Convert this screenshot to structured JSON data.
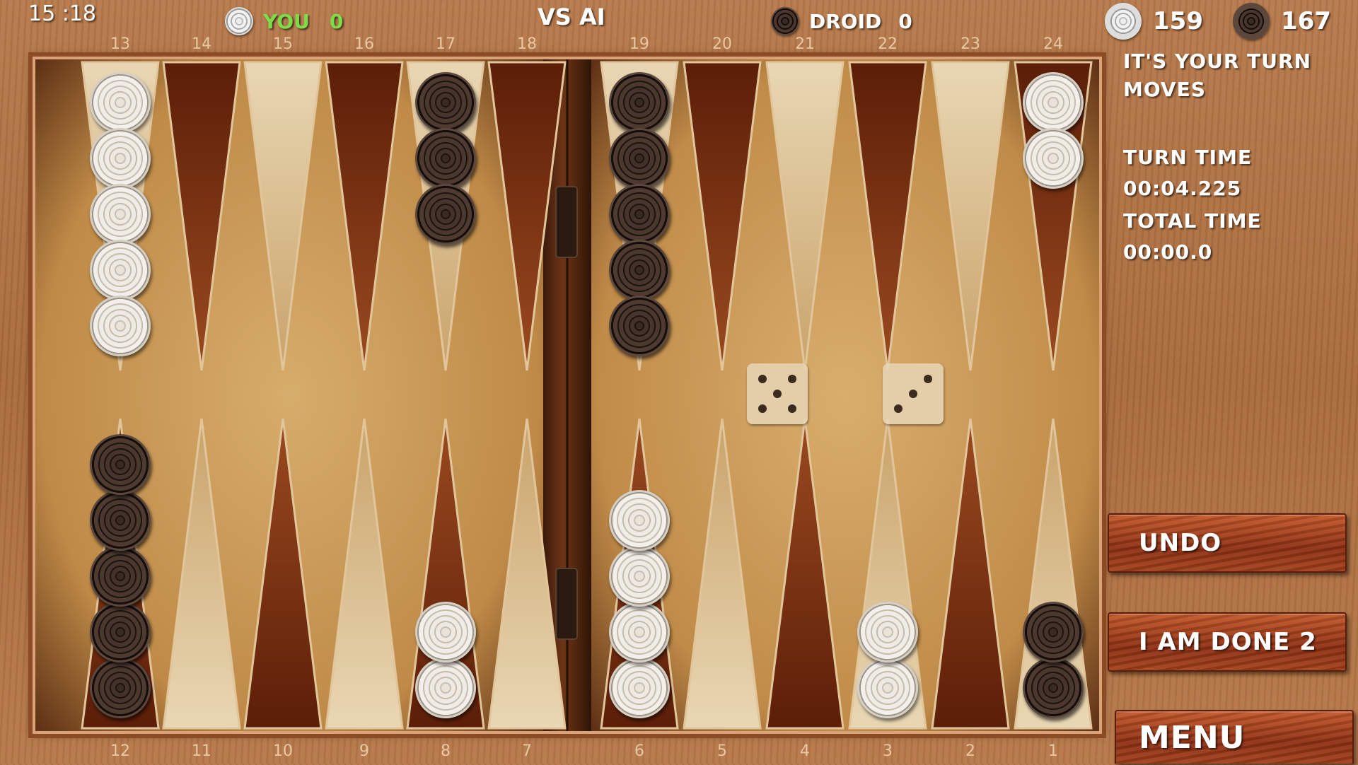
{
  "header": {
    "clock": "15 :18",
    "player_name": "YOU",
    "player_score": "0",
    "mode": "VS AI",
    "opponent_name": "DROID",
    "opponent_score": "0",
    "white_pips": "159",
    "black_pips": "167",
    "colors": {
      "player_name": "#7ddc4a",
      "text": "#ffffff"
    }
  },
  "point_numbers_top": [
    "13",
    "14",
    "15",
    "16",
    "17",
    "18",
    "19",
    "20",
    "21",
    "22",
    "23",
    "24"
  ],
  "point_numbers_bottom": [
    "12",
    "11",
    "10",
    "9",
    "8",
    "7",
    "6",
    "5",
    "4",
    "3",
    "2",
    "1"
  ],
  "side_panel": {
    "turn_message": "IT'S YOUR TURN",
    "moves_label": "MOVES",
    "turn_time_label": "TURN TIME",
    "turn_time_value": "00:04.225",
    "total_time_label": "TOTAL TIME",
    "total_time_value": "00:00.0"
  },
  "buttons": {
    "undo": "UNDO",
    "done": "I AM DONE 2",
    "menu": "MENU"
  },
  "dice": [
    5,
    3
  ],
  "board": {
    "points": [
      {
        "point": 13,
        "color": "white",
        "count": 5
      },
      {
        "point": 17,
        "color": "black",
        "count": 3
      },
      {
        "point": 19,
        "color": "black",
        "count": 5
      },
      {
        "point": 24,
        "color": "white",
        "count": 2
      },
      {
        "point": 12,
        "color": "black",
        "count": 5
      },
      {
        "point": 8,
        "color": "white",
        "count": 2
      },
      {
        "point": 6,
        "color": "white",
        "count": 4
      },
      {
        "point": 3,
        "color": "white",
        "count": 2
      },
      {
        "point": 1,
        "color": "black",
        "count": 2
      }
    ]
  },
  "colors": {
    "board_light": "#d8b583",
    "board_dark_point": "#7e2e10",
    "board_light_point": "#e7d1aa",
    "button": "#a2401b"
  }
}
